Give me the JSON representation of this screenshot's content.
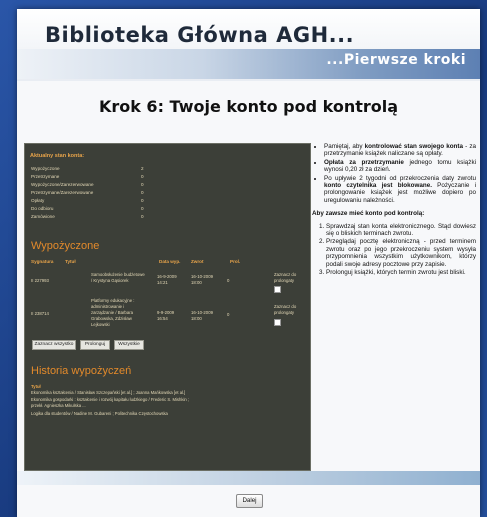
{
  "header": {
    "brand": "Biblioteka Główna AGH...",
    "tagline": "...Pierwsze kroki"
  },
  "step_title": "Krok 6: Twoje konto pod kontrolą",
  "screenshot": {
    "account_title": "Aktualny stan konta:",
    "account_rows": [
      {
        "label": "Wypożyczone",
        "value": "2"
      },
      {
        "label": "Przetrzymane",
        "value": "0"
      },
      {
        "label": "Wypożyczone/Zarezerwowane",
        "value": "0"
      },
      {
        "label": "Przetrzymane/Zarezerwowane",
        "value": "0"
      },
      {
        "label": "Opłaty",
        "value": "0"
      },
      {
        "label": "Do odbioru",
        "value": "0"
      },
      {
        "label": "Zamówione",
        "value": "0"
      }
    ],
    "loans_heading": "Wypożyczone",
    "table_headers": [
      "Sygnatura",
      "Tytuł",
      "Data wyp.",
      "Zwrot",
      "Prol."
    ],
    "rows": [
      {
        "sygn": "II 227993",
        "title_lines": [
          "Samoobsłużenie budżetowe",
          "/ Krystyna Gąsiorek"
        ],
        "date_lines": [
          "16-9-2009",
          "14:21"
        ],
        "due_lines": [
          "16-10-2009",
          "18:00"
        ],
        "prol": "0",
        "extend_lines": [
          "Zaznacz do",
          "prolongaty"
        ]
      },
      {
        "sygn": "II 238714",
        "title_lines": [
          "Platformy edukacyjne :",
          "administrowanie i",
          "zarządzanie / Barbara",
          "Grabowska, Zdzisław",
          "Lejkowski"
        ],
        "date_lines": [
          "9-9-2009",
          "16:54"
        ],
        "due_lines": [
          "16-10-2009",
          "18:00"
        ],
        "prol": "0",
        "extend_lines": [
          "Zaznacz do",
          "prolongaty"
        ]
      }
    ],
    "buttons": [
      "Zaznacz wszystko",
      "Prolonguj",
      "Wszystkie"
    ],
    "history_heading": "Historia wypożyczeń",
    "history_label": "Tytuł",
    "history_lines": [
      "Ekonomika kształcenia / Stanisław Szczepański [et al.] ; Joanna Mańkowska [et al.]",
      "Ekonomika gospodarki : kształcenie i rozwój kapitału ludzkiego / Frederic S. Mishkin ;",
      "przekł. Agnieszka Mikulska ...",
      "Logika dla studentów / Nadine M. Gubareni ; Politechnika Częstochowska"
    ]
  },
  "tips": {
    "bullets": [
      {
        "pre": "Pamiętaj, aby ",
        "bold": "kontrolować stan swojego konta",
        "post": " - za przetrzymanie książek naliczane są opłaty."
      },
      {
        "pre": "",
        "bold": "Opłata za przetrzymanie",
        "post": " jednego tomu książki wynosi 0,20 zł za dzień."
      },
      {
        "pre": "Po upływie 2 tygodni od przekroczenia daty zwrotu ",
        "bold": "konto czytelnika jest blokowane.",
        "post": " Pożyczanie i prolongowanie książek jest możliwe dopiero po uregulowaniu należności."
      }
    ],
    "subheading": "Aby zawsze mieć konto pod kontrolą:",
    "steps": [
      "Sprawdzaj stan konta elektronicznego. Stąd dowiesz się o bliskich terminach zwrotu.",
      "Przeglądaj pocztę elektroniczną - przed terminem zwrotu oraz po jego przekroczeniu system wysyła przypomnienia wszystkim użytkownikom, którzy podali swoje adresy pocztowe przy zapisie.",
      "Prolonguj książki, których termin zwrotu jest bliski."
    ]
  },
  "next_button": "Dalej",
  "colors": {
    "background_blue": "#1d3f86",
    "screenshot_bg": "#3c3f38",
    "accent_orange": "#e38a2b"
  }
}
